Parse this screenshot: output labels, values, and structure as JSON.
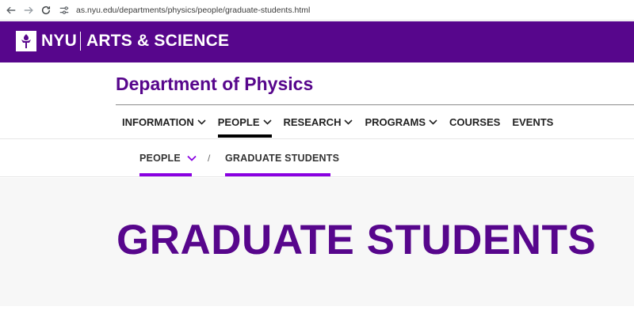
{
  "browser": {
    "url": "as.nyu.edu/departments/physics/people/graduate-students.html",
    "icons": [
      "back-arrow-icon",
      "forward-arrow-icon",
      "reload-icon",
      "site-settings-icon"
    ]
  },
  "header": {
    "logo_icon": "nyu-torch-icon",
    "nyu_label": "NYU",
    "arts_label": "ARTS & SCIENCE",
    "bg_color": "#57068c"
  },
  "department": {
    "title": "Department of Physics"
  },
  "main_nav": {
    "items": [
      {
        "label": "INFORMATION",
        "has_dropdown": true,
        "active": false
      },
      {
        "label": "PEOPLE",
        "has_dropdown": true,
        "active": true
      },
      {
        "label": "RESEARCH",
        "has_dropdown": true,
        "active": false
      },
      {
        "label": "PROGRAMS",
        "has_dropdown": true,
        "active": false
      },
      {
        "label": "COURSES",
        "has_dropdown": false,
        "active": false
      },
      {
        "label": "EVENTS",
        "has_dropdown": false,
        "active": false
      }
    ]
  },
  "breadcrumb": {
    "parent": "PEOPLE",
    "separator": "/",
    "current": "GRADUATE STUDENTS",
    "accent_color": "#8900e1"
  },
  "hero": {
    "title": "GRADUATE STUDENTS",
    "color": "#57068c"
  }
}
